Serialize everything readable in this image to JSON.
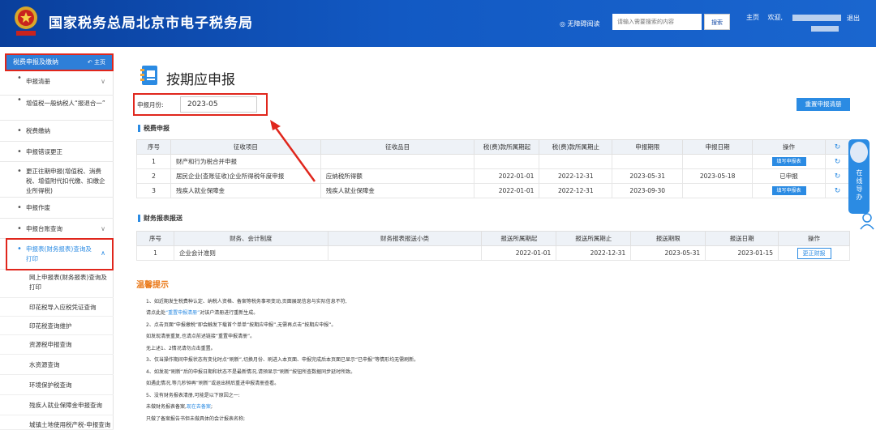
{
  "header": {
    "title": "国家税务总局北京市电子税务局",
    "accessibility": "◎ 无障碍阅读",
    "search_placeholder": "请输入需要搜索的内容",
    "search_button": "搜索",
    "home_link": "主页",
    "welcome": "欢迎,",
    "logout": "退出"
  },
  "sidebar": {
    "head": "税费申报及缴纳",
    "home": "主页",
    "items": [
      {
        "label": "申报清册",
        "chevron": "∨"
      },
      {
        "label": "增值税一般纳税人“报退合一”"
      },
      {
        "label": "税费缴纳"
      },
      {
        "label": "申报错误更正"
      },
      {
        "label": "更正往期申报(增值税、消费税、增值附代扣代缴、扣缴企业所得税)"
      },
      {
        "label": "申报作废"
      },
      {
        "label": "申报台账查询",
        "chevron": "∨"
      },
      {
        "label": "申报表(财务报表)查询及打印",
        "chevron": "∧"
      }
    ],
    "subitems": [
      "网上申报表(财务报表)查询及打印",
      "印花税导入应税凭证查询",
      "印花税查询维护",
      "资源税申报查询",
      "水资源查询",
      "环境保护税查询",
      "残疾人就业保障金申报查询",
      "城镇土地使用税产税-申报查询"
    ]
  },
  "main": {
    "page_title": "按期应申报",
    "month_label": "申报月份:",
    "month_value": "2023-05",
    "reset_button": "重置申报清册",
    "tax_section": "税费申报",
    "tax_headers": [
      "序号",
      "征收项目",
      "征收品目",
      "税(费)款所属期起",
      "税(费)款所属期止",
      "申报期限",
      "申报日期",
      "操作"
    ],
    "tax_rows": [
      {
        "no": "1",
        "item": "财产和行为税合并申报",
        "sub": "",
        "start": "",
        "end": "",
        "deadline": "",
        "date": "",
        "op": "填写申报表"
      },
      {
        "no": "2",
        "item": "居民企业(查账征收)企业所得税年度申报",
        "sub": "应纳税所得额",
        "start": "2022-01-01",
        "end": "2022-12-31",
        "deadline": "2023-05-31",
        "date": "2023-05-18",
        "op": "已申报"
      },
      {
        "no": "3",
        "item": "残疾人就业保障金",
        "sub": "残疾人就业保障金",
        "start": "2022-01-01",
        "end": "2022-12-31",
        "deadline": "2023-09-30",
        "date": "",
        "op": "填写申报表"
      }
    ],
    "fin_section": "财务报表报送",
    "fin_headers": [
      "序号",
      "财务、会计制度",
      "财务报表报送小类",
      "报送所属期起",
      "报送所属期止",
      "报送期限",
      "报送日期",
      "操作"
    ],
    "fin_rows": [
      {
        "no": "1",
        "system": "企业会计准则",
        "sub": "",
        "start": "2022-01-01",
        "end": "2022-12-31",
        "deadline": "2023-05-31",
        "date": "2023-01-15",
        "op": "更正财报"
      }
    ],
    "tips_title": "温馨提示",
    "tips": [
      "1、如近期发生税费种认定、纳税人资格、备案等税务事项变动,页面展现信息与实际信息不符,",
      "请点此处“重置申报清册”对该户清册进行重新生成。",
      "2、点击页面“申报缴税”即会触发下载首个单单“按期应申报”,无需再点击“按期应申报”。",
      "如发现清册重复,也请点前述链接“重置申报清册”。",
      "无上述1、2情况请勿点击重置。",
      "3、仅当操作期间申报状态有变化时点“刷新”,切换月份、刷进入本页面、申报完成后本页面已显示“已申报”等情形均无需刷新。",
      "4、如发现“刷新”后的申报日期和状态不是最新情况,请预显示“刷新”按钮所查数据同步延时所致。",
      "如遇此情况,等几秒钟再“刷新”或退出稍后重进申报清册查看。",
      "5、没有财务报表清册,可能是以下原因之一:",
      "未做财务报表备案,现在去备案;",
      "只做了备案报告书但未做具体的会计报表名称;"
    ],
    "tip_link_1": "“重置申报清册”",
    "tip_link_2": "现在去备案"
  },
  "float_help": {
    "label": "在线导办"
  },
  "colors": {
    "header_blue": "#1259c3",
    "accent_blue": "#2b8be3",
    "alert_red": "#e0261c",
    "tips_orange": "#ea7a1b"
  }
}
